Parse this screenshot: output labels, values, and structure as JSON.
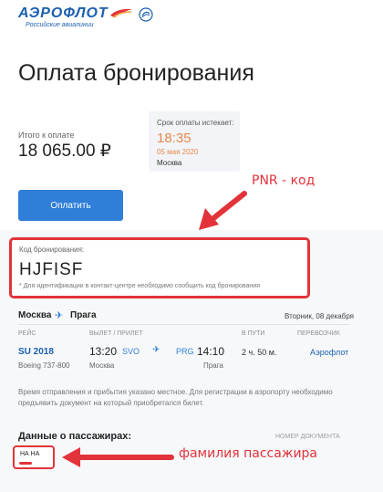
{
  "header": {
    "logo_text": "АЭРОФЛОТ",
    "logo_subtitle": "Российские авиалинии",
    "logo_icon": "aeroflot-wings-icon",
    "badge_icon": "skyteam-badge-icon"
  },
  "page": {
    "title": "Оплата бронирования"
  },
  "payment": {
    "total_label": "Итого к оплате",
    "total_value": "18 065.00 ₽",
    "deadline_label": "Срок оплаты истекает:",
    "deadline_time": "18:35",
    "deadline_date": "05 мая 2020",
    "deadline_city": "Москва",
    "pay_button": "Оплатить"
  },
  "annotations": {
    "pnr_note": "PNR - код",
    "passenger_note": "фамилия пассажира",
    "color": "#e2333a"
  },
  "booking": {
    "label": "Код бронирования:",
    "code": "HJFISF",
    "note": "* Для идентификации в контакт-центре необходимо сообщить код бронирования"
  },
  "route": {
    "from": "Москва",
    "to": "Прага",
    "date": "Вторник, 08 декабря",
    "plane_icon": "plane-icon"
  },
  "flight": {
    "headers": {
      "flight": "РЕЙС",
      "dep_arr": "ВЫЛЕТ / ПРИЛЕТ",
      "duration": "В ПУТИ",
      "carrier": "ПЕРЕВОЗЧИК"
    },
    "number": "SU 2018",
    "aircraft": "Boeing 737-800",
    "dep_time": "13:20",
    "dep_code": "SVO",
    "dep_city": "Москва",
    "arr_code": "PRG",
    "arr_time": "14:10",
    "arr_city": "Прага",
    "duration": "2 ч. 50 м.",
    "carrier": "Аэрофлот"
  },
  "info": {
    "text": "Время отправления и прибытия указано местное. Для регистрации в аэропорту необходимо предъявить документ на который приобретался билет."
  },
  "passengers": {
    "title": "Данные о пассажирах:",
    "doc_header": "НОМЕР ДОКУМЕНТА",
    "name": "НА НА"
  },
  "colors": {
    "brand_blue": "#1b5fae",
    "button_blue": "#2f7ed8",
    "deadline_orange": "#e8884a",
    "highlight_red": "#e2333a"
  }
}
